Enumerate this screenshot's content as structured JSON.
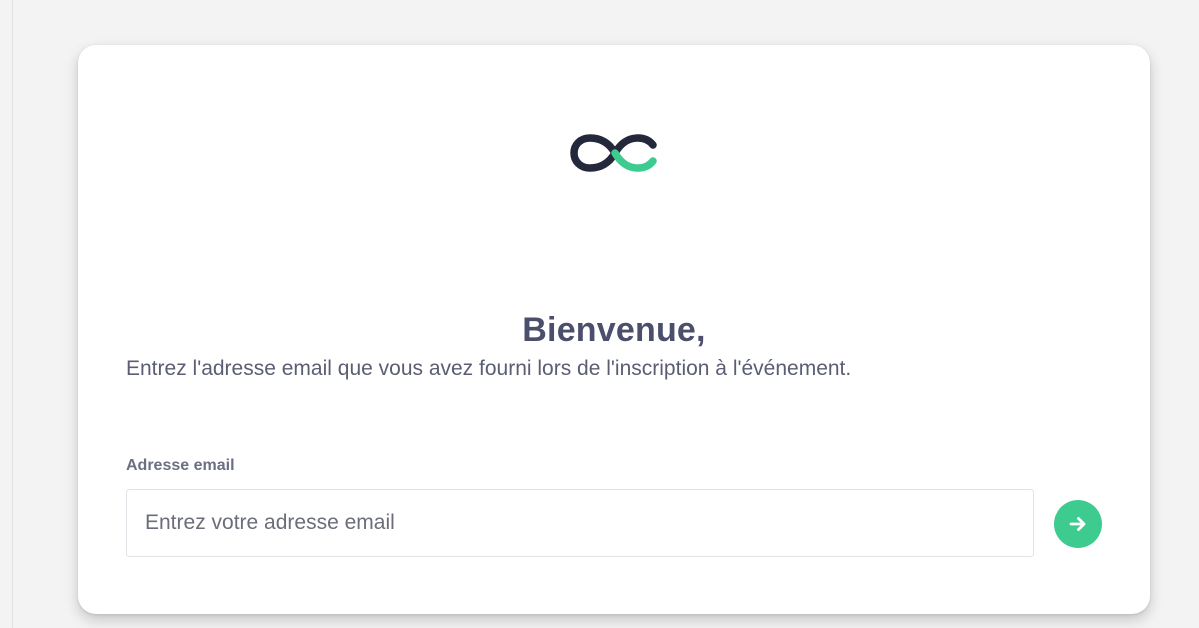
{
  "brand": {
    "logo_icon": "infinity-cc-logo-icon",
    "primary_color": "#23283a",
    "accent_color": "#3ecb8f"
  },
  "login": {
    "title": "Bienvenue,",
    "instructions": "Entrez l'adresse email que vous avez fourni lors de l'inscription à l'événement.",
    "email_label": "Adresse email",
    "email_value": "",
    "email_placeholder": "Entrez votre adresse email",
    "submit_icon": "arrow-right-icon"
  }
}
